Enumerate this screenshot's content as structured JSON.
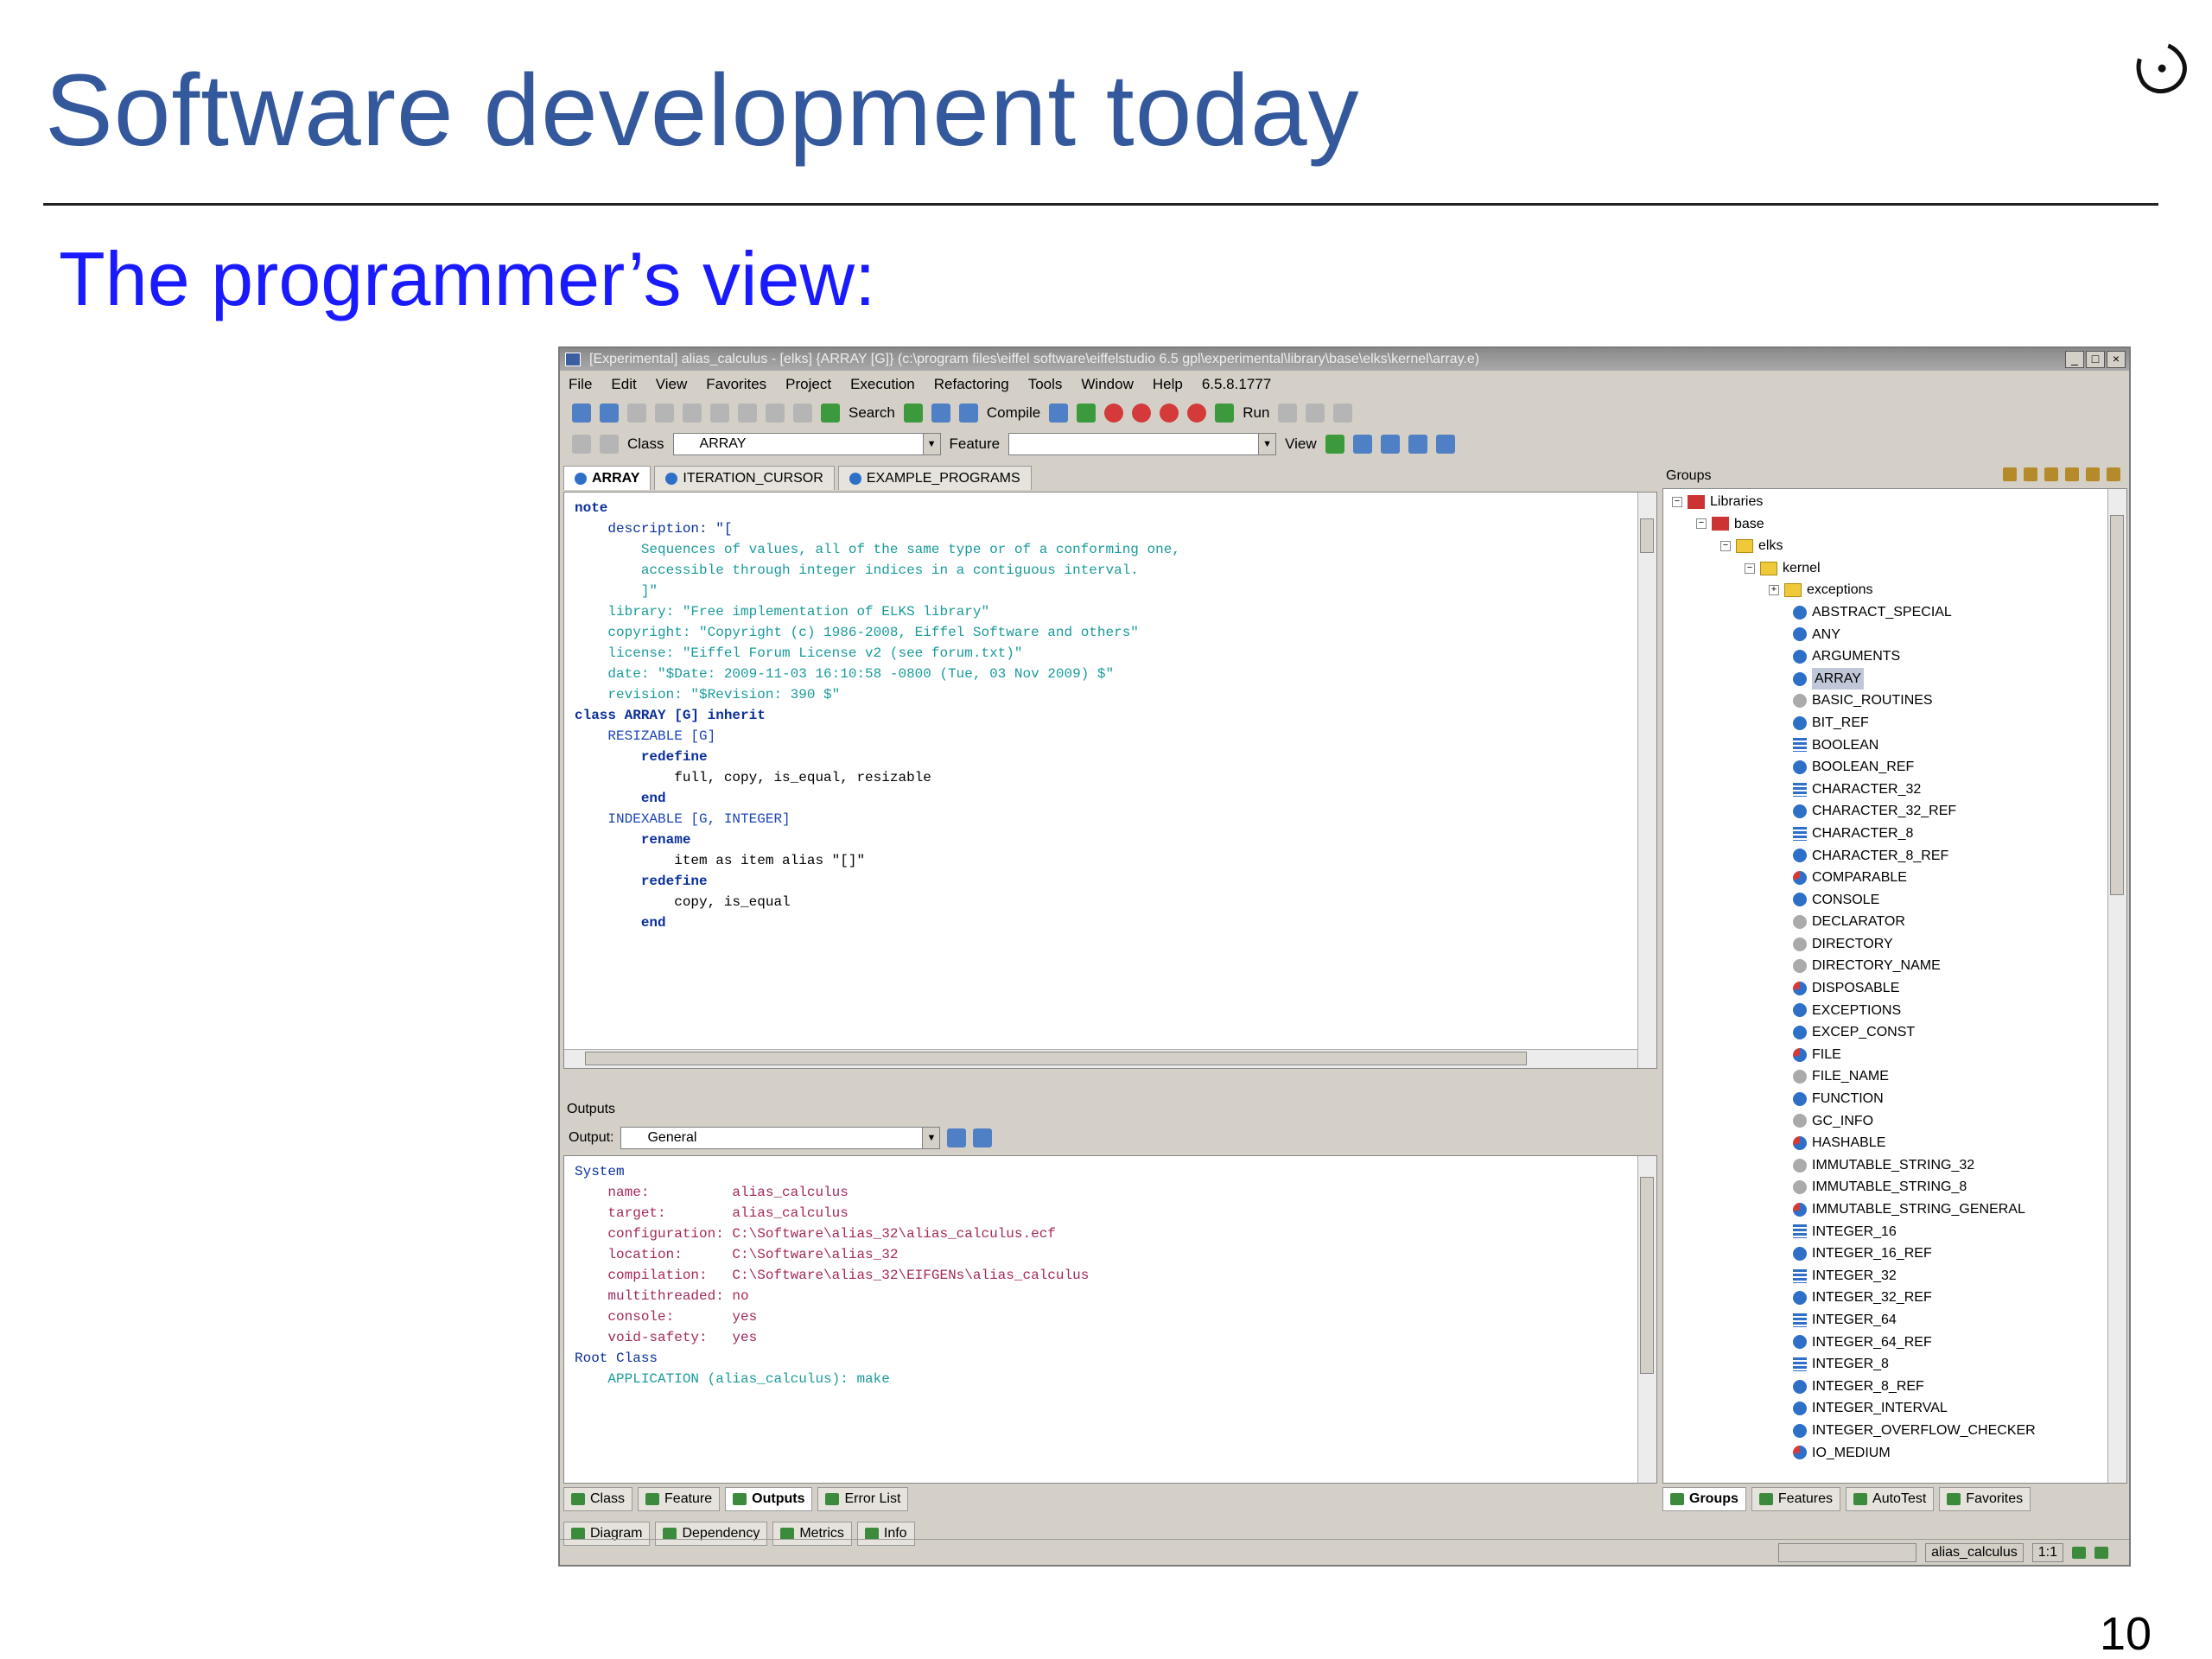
{
  "slide": {
    "title": "Software development today",
    "subtitle": "The programmer’s view:",
    "page_number": "10"
  },
  "window": {
    "title": "[Experimental] alias_calculus - [elks] {ARRAY [G]} (c:\\program files\\eiffel software\\eiffelstudio 6.5 gpl\\experimental\\library\\base\\elks\\kernel\\array.e)",
    "buttons": [
      "_",
      "□",
      "×"
    ]
  },
  "menu": [
    "File",
    "Edit",
    "View",
    "Favorites",
    "Project",
    "Execution",
    "Refactoring",
    "Tools",
    "Window",
    "Help",
    "6.5.8.1777"
  ],
  "toolbar": {
    "search_label": "Search",
    "compile_label": "Compile",
    "run_label": "Run",
    "class_label": "Class",
    "class_value": "ARRAY",
    "feature_label": "Feature",
    "feature_value": "",
    "view_label": "View"
  },
  "editor": {
    "tabs": [
      "ARRAY",
      "ITERATION_CURSOR",
      "EXAMPLE_PROGRAMS"
    ],
    "code_lines": [
      {
        "t": "note",
        "c": "kw"
      },
      {
        "t": "",
        "c": ""
      },
      {
        "t": "    description: \"[",
        "c": "note"
      },
      {
        "t": "        Sequences of values, all of the same type or of a conforming one,",
        "c": "str"
      },
      {
        "t": "        accessible through integer indices in a contiguous interval.",
        "c": "str"
      },
      {
        "t": "        ]\"",
        "c": "str"
      },
      {
        "t": "",
        "c": ""
      },
      {
        "t": "    library: \"Free implementation of ELKS library\"",
        "c": "str"
      },
      {
        "t": "    copyright: \"Copyright (c) 1986-2008, Eiffel Software and others\"",
        "c": "str"
      },
      {
        "t": "    license: \"Eiffel Forum License v2 (see forum.txt)\"",
        "c": "str"
      },
      {
        "t": "    date: \"$Date: 2009-11-03 16:10:58 -0800 (Tue, 03 Nov 2009) $\"",
        "c": "str"
      },
      {
        "t": "    revision: \"$Revision: 390 $\"",
        "c": "str"
      },
      {
        "t": "",
        "c": ""
      },
      {
        "t": "class ARRAY [G] inherit",
        "c": "kw"
      },
      {
        "t": "",
        "c": ""
      },
      {
        "t": "    RESIZABLE [G]",
        "c": "cls"
      },
      {
        "t": "        redefine",
        "c": "kw"
      },
      {
        "t": "            full, copy, is_equal, resizable",
        "c": ""
      },
      {
        "t": "        end",
        "c": "kw"
      },
      {
        "t": "",
        "c": ""
      },
      {
        "t": "    INDEXABLE [G, INTEGER]",
        "c": "cls"
      },
      {
        "t": "        rename",
        "c": "kw"
      },
      {
        "t": "            item as item alias \"[]\"",
        "c": ""
      },
      {
        "t": "        redefine",
        "c": "kw"
      },
      {
        "t": "            copy, is_equal",
        "c": ""
      },
      {
        "t": "        end",
        "c": "kw"
      }
    ]
  },
  "outputs": {
    "header": "Outputs",
    "output_label": "Output:",
    "output_value": "General",
    "lines": [
      {
        "t": "System",
        "c": "out-head-kw"
      },
      {
        "t": "    name:          alias_calculus",
        "c": "out-key"
      },
      {
        "t": "    target:        alias_calculus",
        "c": "out-key"
      },
      {
        "t": "    configuration: C:\\Software\\alias_32\\alias_calculus.ecf",
        "c": "out-key"
      },
      {
        "t": "    location:      C:\\Software\\alias_32",
        "c": "out-key"
      },
      {
        "t": "    compilation:   C:\\Software\\alias_32\\EIFGENs\\alias_calculus",
        "c": "out-key"
      },
      {
        "t": "    multithreaded: no",
        "c": "out-key"
      },
      {
        "t": "    console:       yes",
        "c": "out-key"
      },
      {
        "t": "    void-safety:   yes",
        "c": "out-key"
      },
      {
        "t": "",
        "c": ""
      },
      {
        "t": "Root Class",
        "c": "out-head-kw"
      },
      {
        "t": "    APPLICATION (alias_calculus): make",
        "c": "str"
      }
    ]
  },
  "bottom_tabs_1": [
    "Class",
    "Feature",
    "Outputs",
    "Error List"
  ],
  "bottom_tabs_2": [
    "Diagram",
    "Dependency",
    "Metrics",
    "Info"
  ],
  "groups": {
    "header": "Groups",
    "tabs": [
      "Groups",
      "Features",
      "AutoTest",
      "Favorites"
    ],
    "tree": [
      {
        "label": "Libraries",
        "level": 0,
        "icon": "lib",
        "exp": "−"
      },
      {
        "label": "base",
        "level": 1,
        "icon": "lib",
        "exp": "−"
      },
      {
        "label": "elks",
        "level": 2,
        "icon": "folder",
        "exp": "−"
      },
      {
        "label": "kernel",
        "level": 3,
        "icon": "folder",
        "exp": "−"
      },
      {
        "label": "exceptions",
        "level": 4,
        "icon": "folder",
        "exp": "+"
      },
      {
        "label": "ABSTRACT_SPECIAL",
        "level": 5,
        "icon": "blue"
      },
      {
        "label": "ANY",
        "level": 5,
        "icon": "blue"
      },
      {
        "label": "ARGUMENTS",
        "level": 5,
        "icon": "blue"
      },
      {
        "label": "ARRAY",
        "level": 5,
        "icon": "blue",
        "selected": true
      },
      {
        "label": "BASIC_ROUTINES",
        "level": 5,
        "icon": "gray"
      },
      {
        "label": "BIT_REF",
        "level": 5,
        "icon": "blue"
      },
      {
        "label": "BOOLEAN",
        "level": 5,
        "icon": "grid"
      },
      {
        "label": "BOOLEAN_REF",
        "level": 5,
        "icon": "blue"
      },
      {
        "label": "CHARACTER_32",
        "level": 5,
        "icon": "grid"
      },
      {
        "label": "CHARACTER_32_REF",
        "level": 5,
        "icon": "blue"
      },
      {
        "label": "CHARACTER_8",
        "level": 5,
        "icon": "grid"
      },
      {
        "label": "CHARACTER_8_REF",
        "level": 5,
        "icon": "blue"
      },
      {
        "label": "COMPARABLE",
        "level": 5,
        "icon": "multi"
      },
      {
        "label": "CONSOLE",
        "level": 5,
        "icon": "blue"
      },
      {
        "label": "DECLARATOR",
        "level": 5,
        "icon": "gray"
      },
      {
        "label": "DIRECTORY",
        "level": 5,
        "icon": "gray"
      },
      {
        "label": "DIRECTORY_NAME",
        "level": 5,
        "icon": "gray"
      },
      {
        "label": "DISPOSABLE",
        "level": 5,
        "icon": "multi"
      },
      {
        "label": "EXCEPTIONS",
        "level": 5,
        "icon": "blue"
      },
      {
        "label": "EXCEP_CONST",
        "level": 5,
        "icon": "blue"
      },
      {
        "label": "FILE",
        "level": 5,
        "icon": "multi"
      },
      {
        "label": "FILE_NAME",
        "level": 5,
        "icon": "gray"
      },
      {
        "label": "FUNCTION",
        "level": 5,
        "icon": "blue"
      },
      {
        "label": "GC_INFO",
        "level": 5,
        "icon": "gray"
      },
      {
        "label": "HASHABLE",
        "level": 5,
        "icon": "multi"
      },
      {
        "label": "IMMUTABLE_STRING_32",
        "level": 5,
        "icon": "gray"
      },
      {
        "label": "IMMUTABLE_STRING_8",
        "level": 5,
        "icon": "gray"
      },
      {
        "label": "IMMUTABLE_STRING_GENERAL",
        "level": 5,
        "icon": "multi"
      },
      {
        "label": "INTEGER_16",
        "level": 5,
        "icon": "grid"
      },
      {
        "label": "INTEGER_16_REF",
        "level": 5,
        "icon": "blue"
      },
      {
        "label": "INTEGER_32",
        "level": 5,
        "icon": "grid"
      },
      {
        "label": "INTEGER_32_REF",
        "level": 5,
        "icon": "blue"
      },
      {
        "label": "INTEGER_64",
        "level": 5,
        "icon": "grid"
      },
      {
        "label": "INTEGER_64_REF",
        "level": 5,
        "icon": "blue"
      },
      {
        "label": "INTEGER_8",
        "level": 5,
        "icon": "grid"
      },
      {
        "label": "INTEGER_8_REF",
        "level": 5,
        "icon": "blue"
      },
      {
        "label": "INTEGER_INTERVAL",
        "level": 5,
        "icon": "blue"
      },
      {
        "label": "INTEGER_OVERFLOW_CHECKER",
        "level": 5,
        "icon": "blue"
      },
      {
        "label": "IO_MEDIUM",
        "level": 5,
        "icon": "multi"
      }
    ]
  },
  "status": {
    "target": "alias_calculus",
    "position": "1:1"
  }
}
